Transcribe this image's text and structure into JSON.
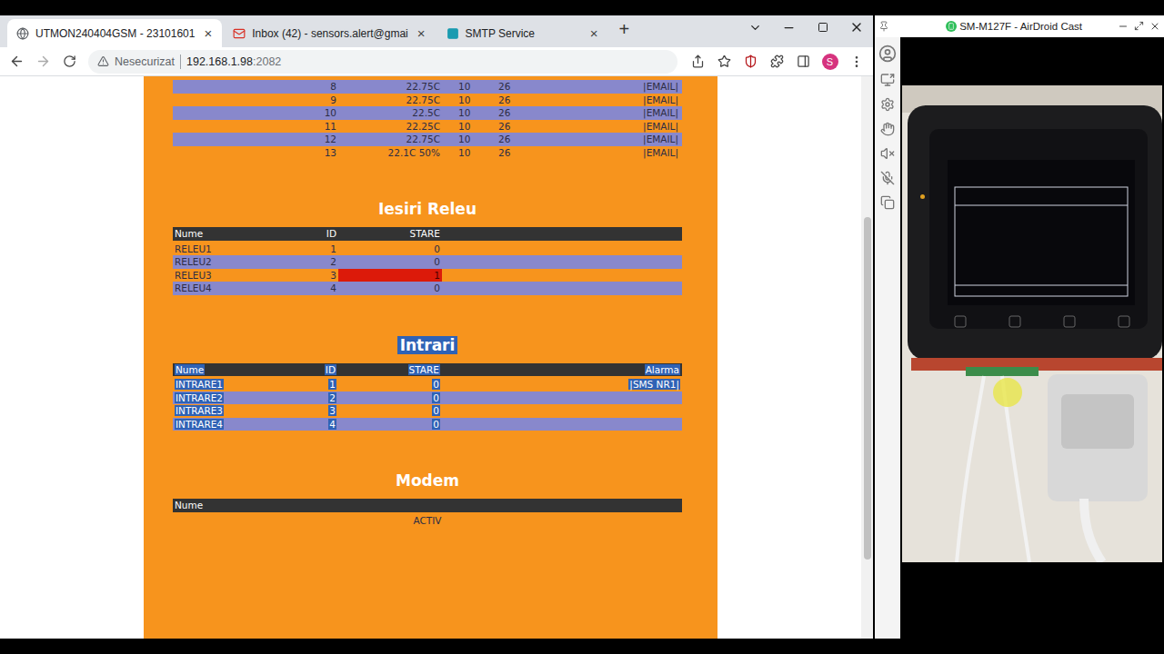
{
  "browser": {
    "tabs": [
      {
        "label": "UTMON240404GSM - 23101601",
        "selected": true,
        "kind": "web",
        "close": "×"
      },
      {
        "label": "Inbox (42) - sensors.alert@gmai",
        "selected": false,
        "kind": "mail",
        "close": "×"
      },
      {
        "label": "SMTP Service",
        "selected": false,
        "kind": "smtp",
        "close": "×"
      }
    ],
    "new_tab": "+",
    "address": {
      "security": "Nesecurizat",
      "host": "192.168.1.98",
      "port": ":2082"
    },
    "profile": "S"
  },
  "scrollbar": {
    "offset": 0.25,
    "size": 0.61
  },
  "sensors": {
    "rows": [
      {
        "id": "8",
        "value": "22.75C",
        "min": "10",
        "max": "26",
        "alarm": "|EMAIL|",
        "shaded": true
      },
      {
        "id": "9",
        "value": "22.75C",
        "min": "10",
        "max": "26",
        "alarm": "|EMAIL|",
        "shaded": false
      },
      {
        "id": "10",
        "value": "22.5C",
        "min": "10",
        "max": "26",
        "alarm": "|EMAIL|",
        "shaded": true
      },
      {
        "id": "11",
        "value": "22.25C",
        "min": "10",
        "max": "26",
        "alarm": "|EMAIL|",
        "shaded": false
      },
      {
        "id": "12",
        "value": "22.75C",
        "min": "10",
        "max": "26",
        "alarm": "|EMAIL|",
        "shaded": true
      },
      {
        "id": "13",
        "value": "22.1C 50%",
        "min": "10",
        "max": "26",
        "alarm": "|EMAIL|",
        "shaded": false
      }
    ]
  },
  "relays": {
    "title": "Iesiri Releu",
    "highlighted": false,
    "columns": [
      "Nume",
      "ID",
      "STARE"
    ],
    "rows": [
      {
        "name": "RELEU1",
        "id": "1",
        "state": "0",
        "active": false,
        "shaded": false
      },
      {
        "name": "RELEU2",
        "id": "2",
        "state": "0",
        "active": false,
        "shaded": true
      },
      {
        "name": "RELEU3",
        "id": "3",
        "state": "1",
        "active": true,
        "shaded": false
      },
      {
        "name": "RELEU4",
        "id": "4",
        "state": "0",
        "active": false,
        "shaded": true
      }
    ]
  },
  "inputs": {
    "title": "Intrari",
    "highlighted": true,
    "columns": [
      "Nume",
      "ID",
      "STARE",
      "Alarma"
    ],
    "rows": [
      {
        "name": "INTRARE1",
        "id": "1",
        "state": "0",
        "alarm": "|SMS NR1|",
        "shaded": false
      },
      {
        "name": "INTRARE2",
        "id": "2",
        "state": "0",
        "alarm": "",
        "shaded": true
      },
      {
        "name": "INTRARE3",
        "id": "3",
        "state": "0",
        "alarm": "",
        "shaded": false
      },
      {
        "name": "INTRARE4",
        "id": "4",
        "state": "0",
        "alarm": "",
        "shaded": true
      }
    ]
  },
  "modem": {
    "title": "Modem",
    "columns": [
      "Nume"
    ],
    "rows": [
      "ACTIV"
    ]
  },
  "cast": {
    "title": "SM-M127F - AirDroid Cast"
  }
}
